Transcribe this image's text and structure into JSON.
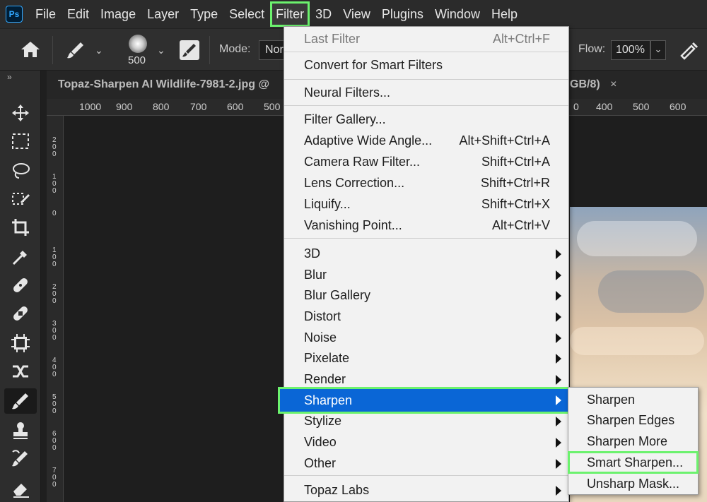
{
  "app": {
    "logo_text": "Ps"
  },
  "menubar": {
    "items": [
      "File",
      "Edit",
      "Image",
      "Layer",
      "Type",
      "Select",
      "Filter",
      "3D",
      "View",
      "Plugins",
      "Window",
      "Help"
    ],
    "active": "Filter"
  },
  "options": {
    "brush_size": "500",
    "mode_label": "Mode:",
    "mode_value": "Nor",
    "flow_label": "Flow:",
    "flow_value": "100%"
  },
  "document": {
    "tab_title_left": "Topaz-Sharpen AI Wildlife-7981-2.jpg @",
    "tab_title_right": "GB/8)",
    "close_glyph": "×"
  },
  "ruler": {
    "top_ticks": [
      "1000",
      "900",
      "800",
      "700",
      "600",
      "500",
      "0",
      "400",
      "500",
      "600"
    ],
    "left_ticks": [
      "200",
      "100",
      "0",
      "100",
      "200",
      "300",
      "400",
      "500",
      "600",
      "700"
    ]
  },
  "filter_menu": {
    "items": [
      {
        "label": "Last Filter",
        "shortcut": "Alt+Ctrl+F",
        "disabled": true
      },
      {
        "label": "Convert for Smart Filters",
        "shortcut": ""
      },
      {
        "label": "Neural Filters...",
        "shortcut": ""
      },
      {
        "label": "Filter Gallery...",
        "shortcut": ""
      },
      {
        "label": "Adaptive Wide Angle...",
        "shortcut": "Alt+Shift+Ctrl+A"
      },
      {
        "label": "Camera Raw Filter...",
        "shortcut": "Shift+Ctrl+A"
      },
      {
        "label": "Lens Correction...",
        "shortcut": "Shift+Ctrl+R"
      },
      {
        "label": "Liquify...",
        "shortcut": "Shift+Ctrl+X"
      },
      {
        "label": "Vanishing Point...",
        "shortcut": "Alt+Ctrl+V"
      },
      {
        "label": "3D",
        "submenu": true
      },
      {
        "label": "Blur",
        "submenu": true
      },
      {
        "label": "Blur Gallery",
        "submenu": true
      },
      {
        "label": "Distort",
        "submenu": true
      },
      {
        "label": "Noise",
        "submenu": true
      },
      {
        "label": "Pixelate",
        "submenu": true
      },
      {
        "label": "Render",
        "submenu": true
      },
      {
        "label": "Sharpen",
        "submenu": true,
        "selected": true
      },
      {
        "label": "Stylize",
        "submenu": true
      },
      {
        "label": "Video",
        "submenu": true
      },
      {
        "label": "Other",
        "submenu": true
      },
      {
        "label": "Topaz Labs",
        "submenu": true
      }
    ]
  },
  "sharpen_submenu": {
    "items": [
      "Sharpen",
      "Sharpen Edges",
      "Sharpen More",
      "Smart Sharpen...",
      "Unsharp Mask..."
    ],
    "highlighted": "Smart Sharpen..."
  },
  "colors": {
    "highlight": "#6cf26e",
    "selection": "#0a66d6",
    "menu_bg": "#f2f2f2"
  }
}
